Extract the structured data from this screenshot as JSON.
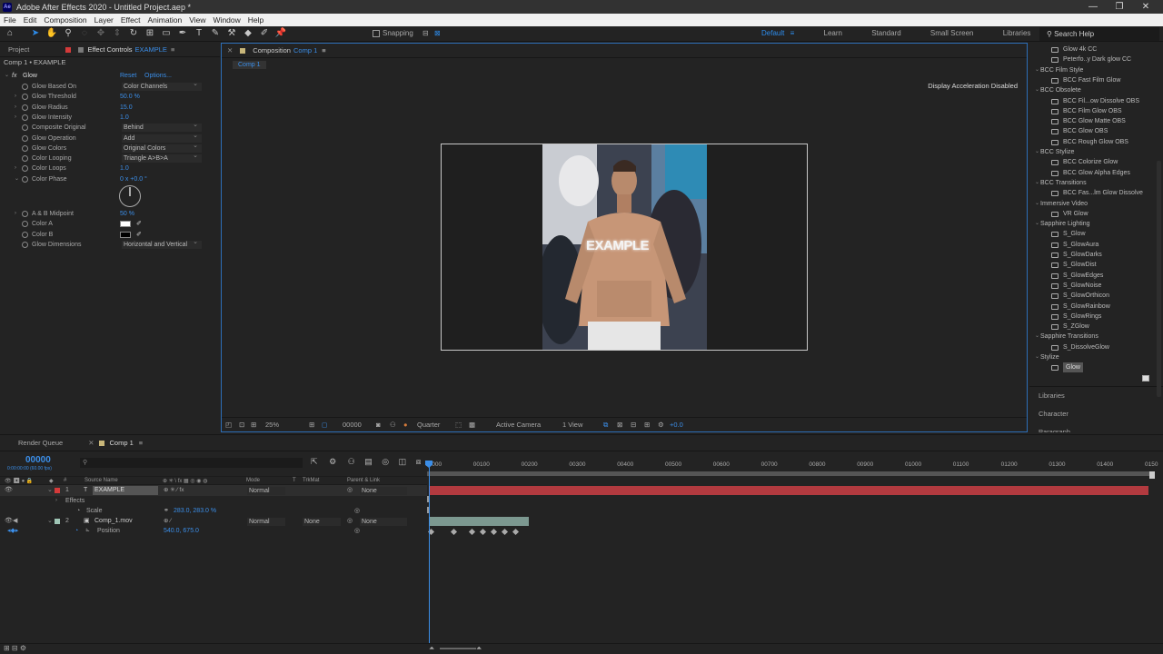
{
  "app": {
    "title": "Adobe After Effects 2020 - Untitled Project.aep *",
    "window_controls": [
      "—",
      "❐",
      "✕"
    ]
  },
  "menu": [
    "File",
    "Edit",
    "Composition",
    "Layer",
    "Effect",
    "Animation",
    "View",
    "Window",
    "Help"
  ],
  "toolbar": {
    "snapping_label": "Snapping",
    "workspaces": [
      "Default",
      "Learn",
      "Standard",
      "Small Screen",
      "Libraries"
    ],
    "active_workspace": "Default",
    "search_placeholder": "Search Help"
  },
  "left_panel": {
    "tab_project": "Project",
    "tab_effect_controls": "Effect Controls",
    "effect_controls_layer": "EXAMPLE",
    "header": "Comp 1 • EXAMPLE",
    "effect_name": "Glow",
    "reset_label": "Reset",
    "options_label": "Options...",
    "params": [
      {
        "name": "Glow Based On",
        "dropdown": "Color Channels"
      },
      {
        "name": "Glow Threshold",
        "value": "50.0 %"
      },
      {
        "name": "Glow Radius",
        "value": "15.0"
      },
      {
        "name": "Glow Intensity",
        "value": "1.0"
      },
      {
        "name": "Composite Original",
        "dropdown": "Behind"
      },
      {
        "name": "Glow Operation",
        "dropdown": "Add"
      },
      {
        "name": "Glow Colors",
        "dropdown": "Original Colors"
      },
      {
        "name": "Color Looping",
        "dropdown": "Triangle A>B>A"
      },
      {
        "name": "Color Loops",
        "value": "1.0"
      },
      {
        "name": "Color Phase",
        "value": "0 x +0.0 °"
      }
    ],
    "params2": [
      {
        "name": "A & B Midpoint",
        "value": "50 %"
      },
      {
        "name": "Color A",
        "swatch": "#ffffff"
      },
      {
        "name": "Color B",
        "swatch": "#000000"
      },
      {
        "name": "Glow Dimensions",
        "dropdown": "Horizontal and Vertical"
      }
    ]
  },
  "composition": {
    "tab_label": "Composition",
    "comp_name": "Comp 1",
    "sub_tab": "Comp 1",
    "display_accel": "Display Acceleration Disabled",
    "overlay_text": "EXAMPLE",
    "footer": {
      "zoom": "25%",
      "timecode": "00000",
      "resolution": "Quarter",
      "camera": "Active Camera",
      "views": "1 View",
      "exposure": "+0.0"
    }
  },
  "effects_panel": {
    "items": [
      {
        "type": "item",
        "name": "Glow 4k CC"
      },
      {
        "type": "item",
        "name": "Peterfo..y Dark glow CC"
      },
      {
        "type": "cat",
        "name": "BCC Film Style"
      },
      {
        "type": "item",
        "name": "BCC Fast Film Glow"
      },
      {
        "type": "cat",
        "name": "BCC Obsolete"
      },
      {
        "type": "item",
        "name": "BCC Fil...ow Dissolve OBS"
      },
      {
        "type": "item",
        "name": "BCC Film Glow OBS"
      },
      {
        "type": "item",
        "name": "BCC Glow Matte OBS"
      },
      {
        "type": "item",
        "name": "BCC Glow OBS"
      },
      {
        "type": "item",
        "name": "BCC Rough Glow OBS"
      },
      {
        "type": "cat",
        "name": "BCC Stylize"
      },
      {
        "type": "item",
        "name": "BCC Colorize Glow"
      },
      {
        "type": "item",
        "name": "BCC Glow Alpha Edges"
      },
      {
        "type": "cat",
        "name": "BCC Transitions"
      },
      {
        "type": "item",
        "name": "BCC Fas...lm Glow Dissolve"
      },
      {
        "type": "cat",
        "name": "Immersive Video"
      },
      {
        "type": "item",
        "name": "VR Glow"
      },
      {
        "type": "cat",
        "name": "Sapphire Lighting"
      },
      {
        "type": "item",
        "name": "S_Glow"
      },
      {
        "type": "item",
        "name": "S_GlowAura"
      },
      {
        "type": "item",
        "name": "S_GlowDarks"
      },
      {
        "type": "item",
        "name": "S_GlowDist"
      },
      {
        "type": "item",
        "name": "S_GlowEdges"
      },
      {
        "type": "item",
        "name": "S_GlowNoise"
      },
      {
        "type": "item",
        "name": "S_GlowOrthicon"
      },
      {
        "type": "item",
        "name": "S_GlowRainbow"
      },
      {
        "type": "item",
        "name": "S_GlowRings"
      },
      {
        "type": "item",
        "name": "S_ZGlow"
      },
      {
        "type": "cat",
        "name": "Sapphire Transitions"
      },
      {
        "type": "item",
        "name": "S_DissolveGlow"
      },
      {
        "type": "cat",
        "name": "Stylize"
      },
      {
        "type": "item",
        "name": "Glow",
        "selected": true
      }
    ],
    "sections": [
      "Libraries",
      "Character",
      "Paragraph"
    ]
  },
  "timeline": {
    "tab_render_queue": "Render Queue",
    "tab_comp": "Comp 1",
    "timecode": "00000",
    "fps": "0:00:00:00 (60.00 fps)",
    "ruler": [
      "00000",
      "00100",
      "00200",
      "00300",
      "00400",
      "00500",
      "00600",
      "00700",
      "00800",
      "00900",
      "01000",
      "01100",
      "01200",
      "01300",
      "01400",
      "0150"
    ],
    "columns": {
      "source_name": "Source Name",
      "mode": "Mode",
      "t": "T",
      "trkmat": "TrkMat",
      "parent": "Parent & Link"
    },
    "layers": [
      {
        "num": "1",
        "name": "EXAMPLE",
        "mode": "Normal",
        "parent": "None",
        "label_color": "#d43a3a"
      },
      {
        "num": "2",
        "name": "Comp_1.mov",
        "mode": "Normal",
        "trkmat": "None",
        "parent": "None",
        "label_color": "#9fc5b5"
      }
    ],
    "sub_rows": {
      "effects": "Effects",
      "scale_label": "Scale",
      "scale_value": "283.0, 283.0 %",
      "position_label": "Position",
      "position_value": "540.0, 675.0"
    },
    "keyframes_count": 7
  }
}
